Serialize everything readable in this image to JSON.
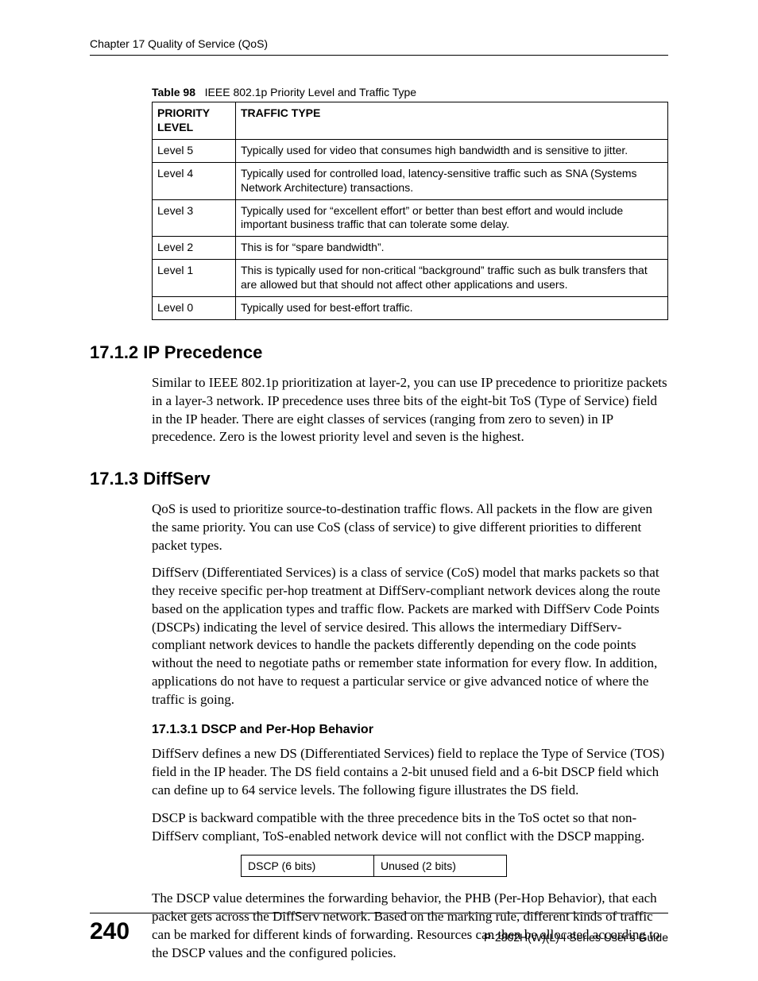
{
  "header": {
    "chapter_line": "Chapter 17 Quality of Service (QoS)"
  },
  "table98": {
    "caption_label": "Table 98",
    "caption_text": "IEEE 802.1p Priority Level and Traffic Type",
    "headers": {
      "col1": "PRIORITY LEVEL",
      "col2": "TRAFFIC TYPE"
    },
    "rows": [
      {
        "level": "Level 5",
        "desc": "Typically used for video that consumes high bandwidth and is sensitive to jitter."
      },
      {
        "level": "Level 4",
        "desc": "Typically used for controlled load, latency-sensitive traffic such as SNA (Systems Network Architecture) transactions."
      },
      {
        "level": "Level 3",
        "desc": "Typically used for “excellent effort” or better than best effort and would include important business traffic that can tolerate some delay."
      },
      {
        "level": "Level 2",
        "desc": "This is for “spare bandwidth”."
      },
      {
        "level": "Level 1",
        "desc": "This is typically used for non-critical “background” traffic such as bulk transfers that are allowed but that should not affect other applications and users."
      },
      {
        "level": "Level 0",
        "desc": "Typically used for best-effort traffic."
      }
    ]
  },
  "sections": {
    "s1712": {
      "heading": "17.1.2  IP Precedence",
      "para1": "Similar to IEEE 802.1p prioritization at layer-2, you can use IP precedence to prioritize packets in a layer-3 network. IP precedence uses three bits of the eight-bit ToS (Type of Service) field in the IP header. There are eight classes of services (ranging from zero to seven) in IP precedence. Zero is the lowest priority level and seven is the highest."
    },
    "s1713": {
      "heading": "17.1.3  DiffServ",
      "para1": "QoS is used to prioritize source-to-destination traffic flows. All packets in the flow are given the same priority. You can use CoS (class of service) to give different priorities to different packet types.",
      "para2": "DiffServ (Differentiated Services) is a class of service (CoS) model that marks packets so that they receive specific per-hop treatment at DiffServ-compliant network devices along the route based on the application types and traffic flow. Packets are marked with DiffServ Code Points (DSCPs) indicating the level of service desired. This allows the intermediary DiffServ-compliant network devices to handle the packets differently depending on the code points without the need to negotiate paths or remember state information for every flow. In addition, applications do not have to request a particular service or give advanced notice of where the traffic is going."
    },
    "s17131": {
      "heading": "17.1.3.1  DSCP and Per-Hop Behavior",
      "para1": "DiffServ defines a new DS (Differentiated Services) field to replace the Type of Service (TOS) field in the IP header. The DS field contains a 2-bit unused field and a 6-bit DSCP field which can define up to 64 service levels. The following figure illustrates the DS field.",
      "para2": "DSCP is backward compatible with the three precedence bits in the ToS octet so that non-DiffServ compliant, ToS-enabled network device will not conflict with the DSCP mapping.",
      "para3": "The DSCP value determines the forwarding behavior, the PHB (Per-Hop Behavior), that each packet gets across the DiffServ network. Based on the marking rule, different kinds of traffic can be marked for different kinds of forwarding. Resources can then be allocated according to the DSCP values and the configured policies."
    }
  },
  "ds_field": {
    "cell1": "DSCP (6 bits)",
    "cell2": "Unused (2 bits)"
  },
  "footer": {
    "page_number": "240",
    "guide": "P-2802H(W)(L)-I Series User’s Guide"
  }
}
